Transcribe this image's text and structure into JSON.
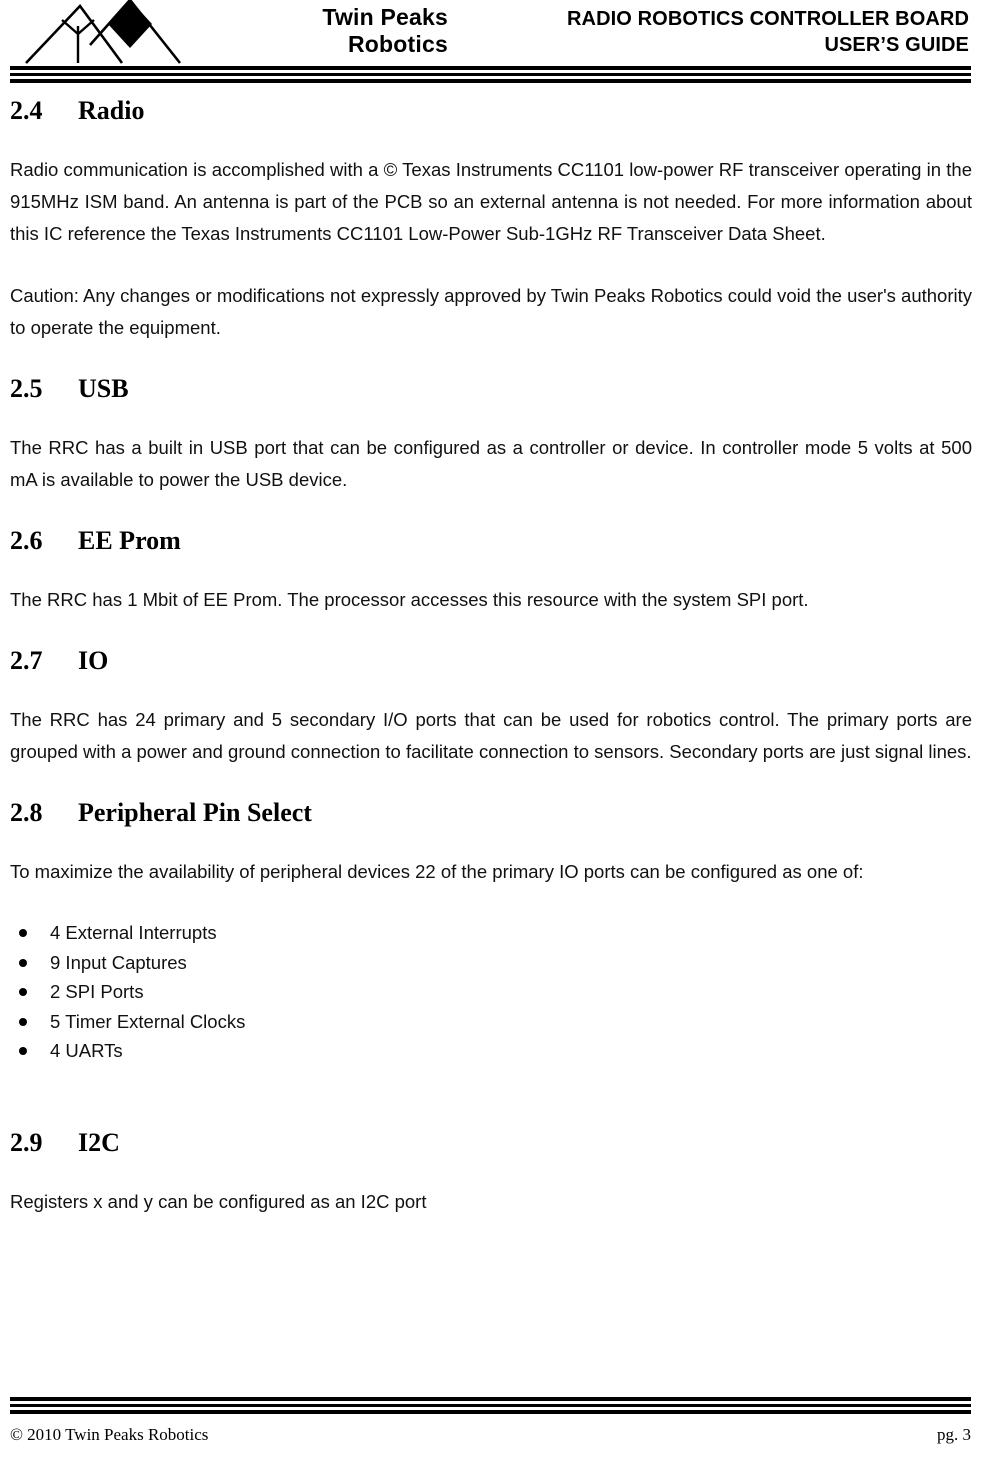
{
  "header": {
    "logo": {
      "icon_name": "twin-peaks-mountains-antenna-logo",
      "line1": "Twin Peaks",
      "line2": "Robotics"
    },
    "title_line1": "RADIO ROBOTICS CONTROLLER BOARD",
    "title_line2": "USER’S GUIDE"
  },
  "sections": [
    {
      "number": "2.4",
      "title": "Radio",
      "paragraphs": [
        "Radio communication is accomplished with a © Texas Instruments CC1101 low-power RF transceiver operating in the 915MHz ISM band.  An antenna is part of the PCB so an external antenna is not needed.  For more information about this IC reference the Texas Instruments CC1101 Low-Power Sub-1GHz RF Transceiver Data Sheet.",
        "Caution: Any changes or modifications not expressly approved by Twin Peaks Robotics could void the user's authority to operate the equipment."
      ]
    },
    {
      "number": "2.5",
      "title": "USB",
      "paragraphs": [
        "The RRC has a built in USB port that can be configured as a controller or device.  In controller mode 5 volts at 500 mA is available to power the USB device."
      ]
    },
    {
      "number": "2.6",
      "title": "EE Prom",
      "paragraphs": [
        "The RRC has 1 Mbit of EE Prom.  The processor accesses this resource with the system SPI port."
      ]
    },
    {
      "number": "2.7",
      "title": "IO",
      "paragraphs": [
        "The RRC has 24 primary and 5 secondary I/O ports that can be used for robotics control.  The primary ports are grouped with a power and ground connection to facilitate connection to sensors.  Secondary ports are just signal lines."
      ]
    },
    {
      "number": "2.8",
      "title": "Peripheral Pin Select",
      "paragraphs": [
        "To maximize the availability of peripheral devices 22 of the primary IO ports can be configured as one of:"
      ],
      "bullets": [
        "4 External Interrupts",
        "9 Input Captures",
        "2 SPI Ports",
        "5 Timer External Clocks",
        "4 UARTs"
      ]
    },
    {
      "number": "2.9",
      "title": "I2C",
      "paragraphs": [
        "Registers x and y can be configured as an I2C port"
      ]
    }
  ],
  "footer": {
    "copyright": "© 2010 Twin Peaks Robotics",
    "page": "pg. 3"
  },
  "colors": {
    "text": "#000000",
    "background": "#ffffff",
    "rule": "#000000"
  }
}
